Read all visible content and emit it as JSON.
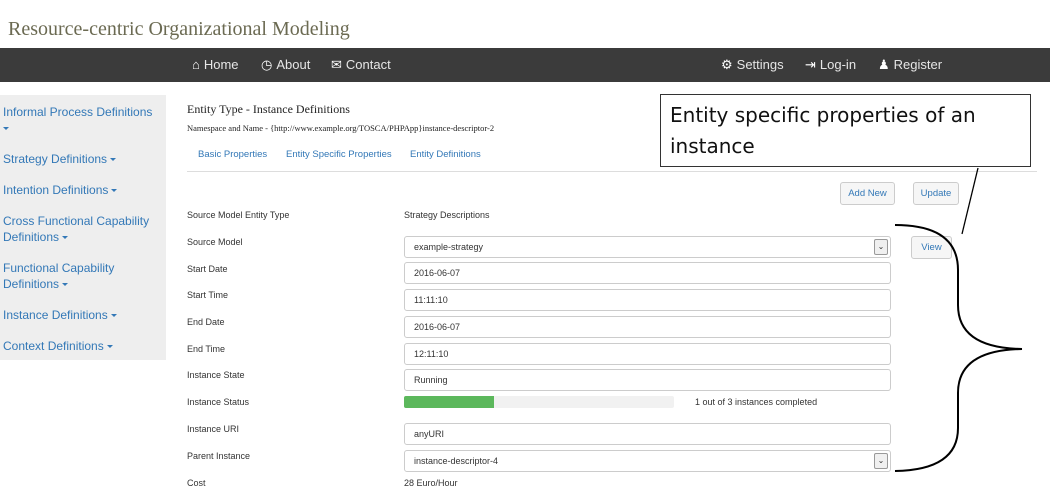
{
  "app_title": "Resource-centric Organizational Modeling",
  "navbar": {
    "left": [
      {
        "label": "Home",
        "icon": "home-icon",
        "glyph": "⌂"
      },
      {
        "label": "About",
        "icon": "clock-icon",
        "glyph": "◷"
      },
      {
        "label": "Contact",
        "icon": "envelope-icon",
        "glyph": "✉"
      }
    ],
    "right": [
      {
        "label": "Settings",
        "icon": "gear-icon",
        "glyph": "⚙"
      },
      {
        "label": "Log-in",
        "icon": "login-icon",
        "glyph": "⇥"
      },
      {
        "label": "Register",
        "icon": "user-icon",
        "glyph": "♟"
      }
    ]
  },
  "sidebar": {
    "items": [
      {
        "label": "Informal Process Definitions"
      },
      {
        "label": "Strategy Definitions"
      },
      {
        "label": "Intention Definitions"
      },
      {
        "label": "Cross Functional Capability Definitions"
      },
      {
        "label": "Functional Capability Definitions"
      },
      {
        "label": "Instance Definitions"
      },
      {
        "label": "Context Definitions"
      }
    ]
  },
  "entity": {
    "title": "Entity Type - Instance Definitions",
    "namespace": "Namespace and Name - {http://www.example.org/TOSCA/PHPApp}instance-descriptor-2"
  },
  "tabs": [
    "Basic Properties",
    "Entity Specific Properties",
    "Entity Definitions"
  ],
  "buttons": {
    "add_new": "Add New",
    "update": "Update",
    "view": "View"
  },
  "form": {
    "source_model_entity_type": {
      "label": "Source Model Entity Type",
      "value": "Strategy Descriptions"
    },
    "source_model": {
      "label": "Source Model",
      "value": "example-strategy"
    },
    "start_date": {
      "label": "Start Date",
      "value": "2016-06-07"
    },
    "start_time": {
      "label": "Start Time",
      "value": "11:11:10"
    },
    "end_date": {
      "label": "End Date",
      "value": "2016-06-07"
    },
    "end_time": {
      "label": "End Time",
      "value": "12:11:10"
    },
    "instance_state": {
      "label": "Instance State",
      "value": "Running"
    },
    "instance_status": {
      "label": "Instance Status",
      "text": "1 out of 3 instances completed",
      "progress": 0.3333
    },
    "instance_uri": {
      "label": "Instance URI",
      "value": "anyURI"
    },
    "parent_instance": {
      "label": "Parent Instance",
      "value": "instance-descriptor-4"
    },
    "cost": {
      "label": "Cost",
      "value": "28 Euro/Hour"
    }
  },
  "callout": {
    "text": "Entity specific properties of an instance"
  },
  "colors": {
    "navbar": "#3b3b3b",
    "link": "#3378b7",
    "progress": "#5cb85c",
    "sidebar_bg": "#eeeeee"
  }
}
